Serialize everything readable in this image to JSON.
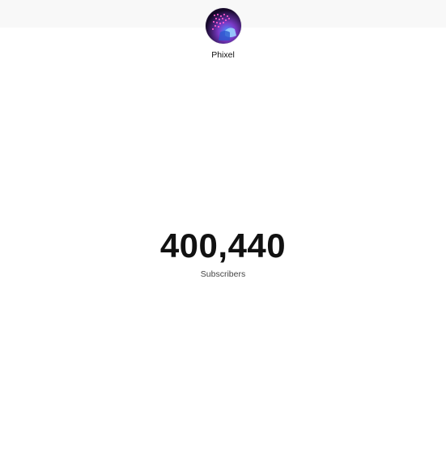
{
  "channel": {
    "name": "Phixel",
    "avatar_icon": "channel-avatar-image"
  },
  "stats": {
    "subscriber_count": "400,440",
    "subscriber_label": "Subscribers"
  },
  "colors": {
    "top_band": "#f8f8f8",
    "text_primary": "#111111",
    "text_secondary": "#444444"
  }
}
